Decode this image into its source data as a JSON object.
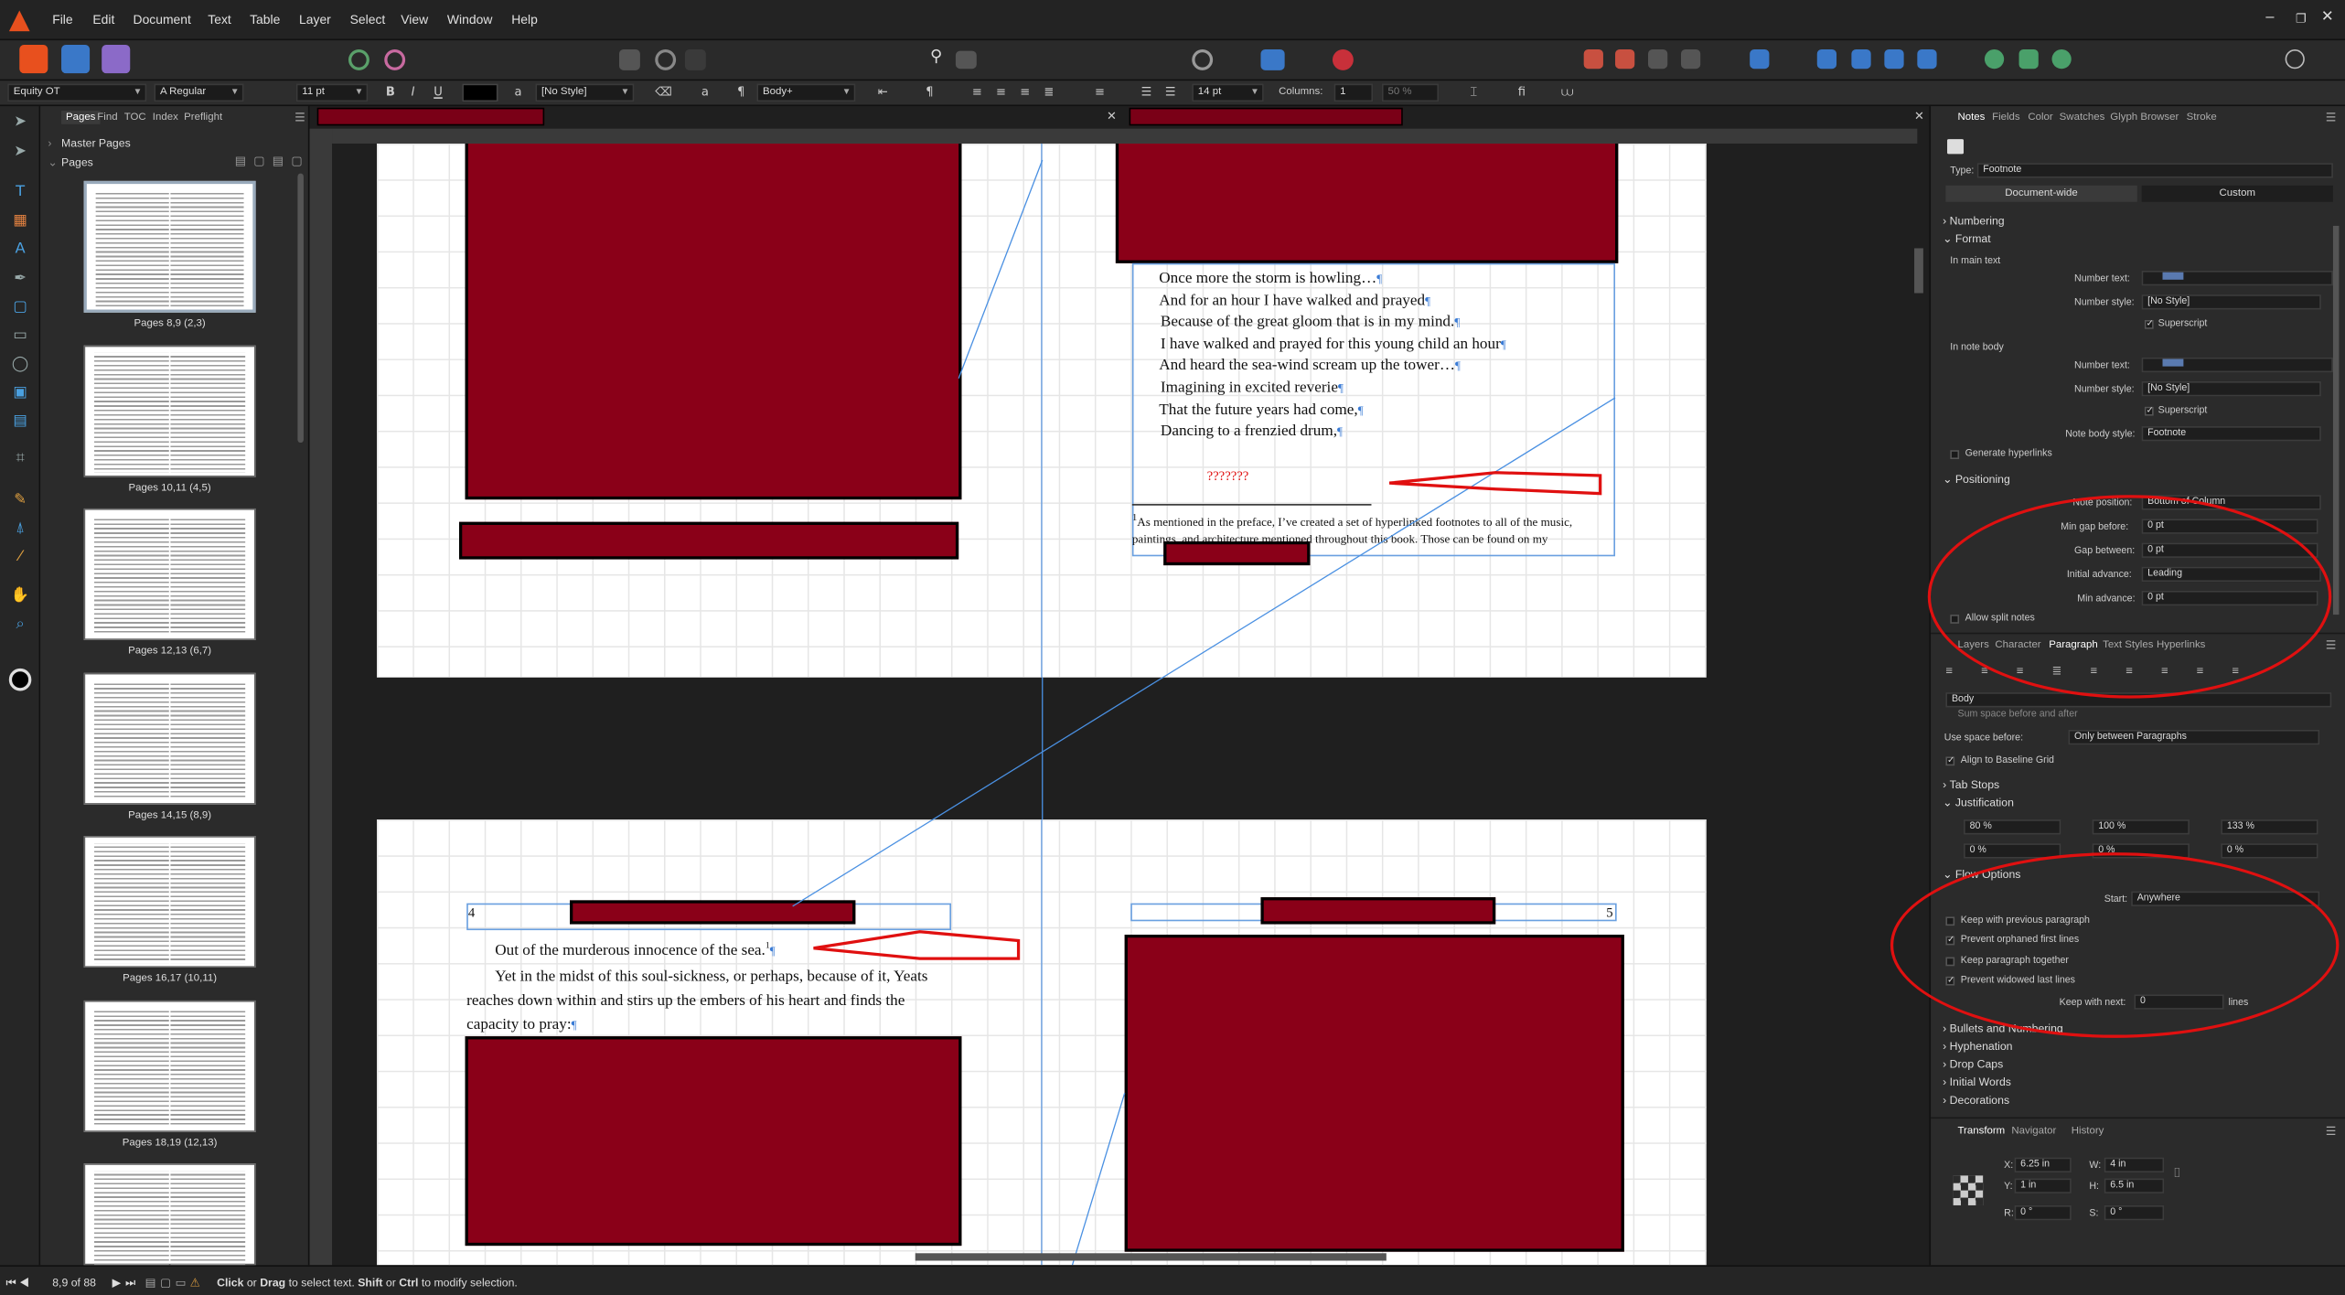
{
  "menu": [
    "File",
    "Edit",
    "Document",
    "Text",
    "Table",
    "Layer",
    "Select",
    "View",
    "Window",
    "Help"
  ],
  "context": {
    "font": "Equity OT",
    "font_style": "A Regular",
    "font_size": "11 pt",
    "char_style": "[No Style]",
    "para_style": "Body+",
    "leading": "14 pt",
    "columns_label": "Columns:",
    "columns": "1",
    "zoom": "50 %"
  },
  "pages_panel": {
    "tabs": [
      "Pages",
      "Find",
      "TOC",
      "Index",
      "Preflight"
    ],
    "master_pages": "Master Pages",
    "pages": "Pages",
    "thumbs": [
      "Pages 8,9 (2,3)",
      "Pages 10,11 (4,5)",
      "Pages 12,13 (6,7)",
      "Pages 14,15 (8,9)",
      "Pages 16,17 (10,11)",
      "Pages 18,19 (12,13)"
    ]
  },
  "document": {
    "poem": [
      "Once more the storm is howling…",
      "And for an hour I have walked and prayed",
      "Because of the great gloom that is in my mind.",
      "I have walked and prayed for this young child an hour",
      "And heard the sea-wind scream up the tower…",
      "Imagining in excited reverie",
      "That the future years had come,",
      "Dancing to a frenzied drum,"
    ],
    "marker": "???????",
    "footnote_num": "1",
    "footnote": "As mentioned in the preface, I’ve created a set of hyperlinked footnotes to all of the music, paintings, and architecture mentioned throughout this book. Those can be found on my",
    "page_num_left": "4",
    "page_num_right": "5",
    "line1": "Out of the murderous innocence of the sea.",
    "line1_ref": "1",
    "para": "Yet in the midst of this soul-sickness, or perhaps, because of it, Yeats reaches down within and stirs up the embers of his heart and finds the capacity to pray:",
    "pilcrow": "¶"
  },
  "notes_panel": {
    "tabs": [
      "Notes",
      "Fields",
      "Color",
      "Swatches",
      "Glyph Browser",
      "Stroke"
    ],
    "type_label": "Type:",
    "type_value": "Footnote",
    "scope": [
      "Document-wide",
      "Custom"
    ],
    "numbering": "Numbering",
    "format": "Format",
    "in_main_text": "In main text",
    "number_text_label": "Number text:",
    "number_style_label": "Number style:",
    "number_style_value": "[No Style]",
    "superscript": "Superscript",
    "in_note_body": "In note body",
    "note_body_style_label": "Note body style:",
    "note_body_style_value": "Footnote",
    "generate_hyperlinks": "Generate hyperlinks",
    "positioning": "Positioning",
    "note_position_label": "Note position:",
    "note_position_value": "Bottom of Column",
    "min_gap_label": "Min gap before:",
    "min_gap_value": "0 pt",
    "gap_between_label": "Gap between:",
    "gap_between_value": "0 pt",
    "initial_advance_label": "Initial advance:",
    "initial_advance_value": "Leading",
    "min_advance_label": "Min advance:",
    "min_advance_value": "0 pt",
    "allow_split": "Allow split notes"
  },
  "para_panel": {
    "tabs": [
      "Layers",
      "Character",
      "Paragraph",
      "Text Styles",
      "Hyperlinks"
    ],
    "style": "Body",
    "sum_space": "Sum space before and after",
    "use_space_label": "Use space before:",
    "use_space_value": "Only between Paragraphs",
    "align_baseline": "Align to Baseline Grid",
    "tab_stops": "Tab Stops",
    "justification": "Justification",
    "just_values": [
      "80 %",
      "100 %",
      "133 %",
      "0 %",
      "0 %",
      "0 %"
    ],
    "flow_options": "Flow Options",
    "start_label": "Start:",
    "start_value": "Anywhere",
    "keep_prev": "Keep with previous paragraph",
    "prevent_orphan": "Prevent orphaned first lines",
    "keep_together": "Keep paragraph together",
    "prevent_widow": "Prevent widowed last lines",
    "keep_next_label": "Keep with next:",
    "keep_next_value": "0",
    "lines": "lines",
    "sections": [
      "Bullets and Numbering",
      "Hyphenation",
      "Drop Caps",
      "Initial Words",
      "Decorations"
    ]
  },
  "transform_panel": {
    "tabs": [
      "Transform",
      "Navigator",
      "History"
    ],
    "x_label": "X:",
    "x": "6.25 in",
    "y_label": "Y:",
    "y": "1 in",
    "w_label": "W:",
    "w": "4 in",
    "h_label": "H:",
    "h": "6.5 in",
    "r_label": "R:",
    "r": "0 °",
    "s_label": "S:",
    "s": "0 °"
  },
  "status": {
    "page": "8,9 of 88",
    "hint_prefix": "Click",
    "hint_or": "or",
    "hint_drag": "Drag",
    "hint_mid": "to select text.",
    "hint_shift": "Shift",
    "hint_or2": "or",
    "hint_ctrl": "Ctrl",
    "hint_end": "to modify selection."
  },
  "colors": {
    "accent": "#e8501e",
    "redaction": "#8a0018",
    "annotation": "#e01010",
    "guide": "#4a90e2"
  }
}
